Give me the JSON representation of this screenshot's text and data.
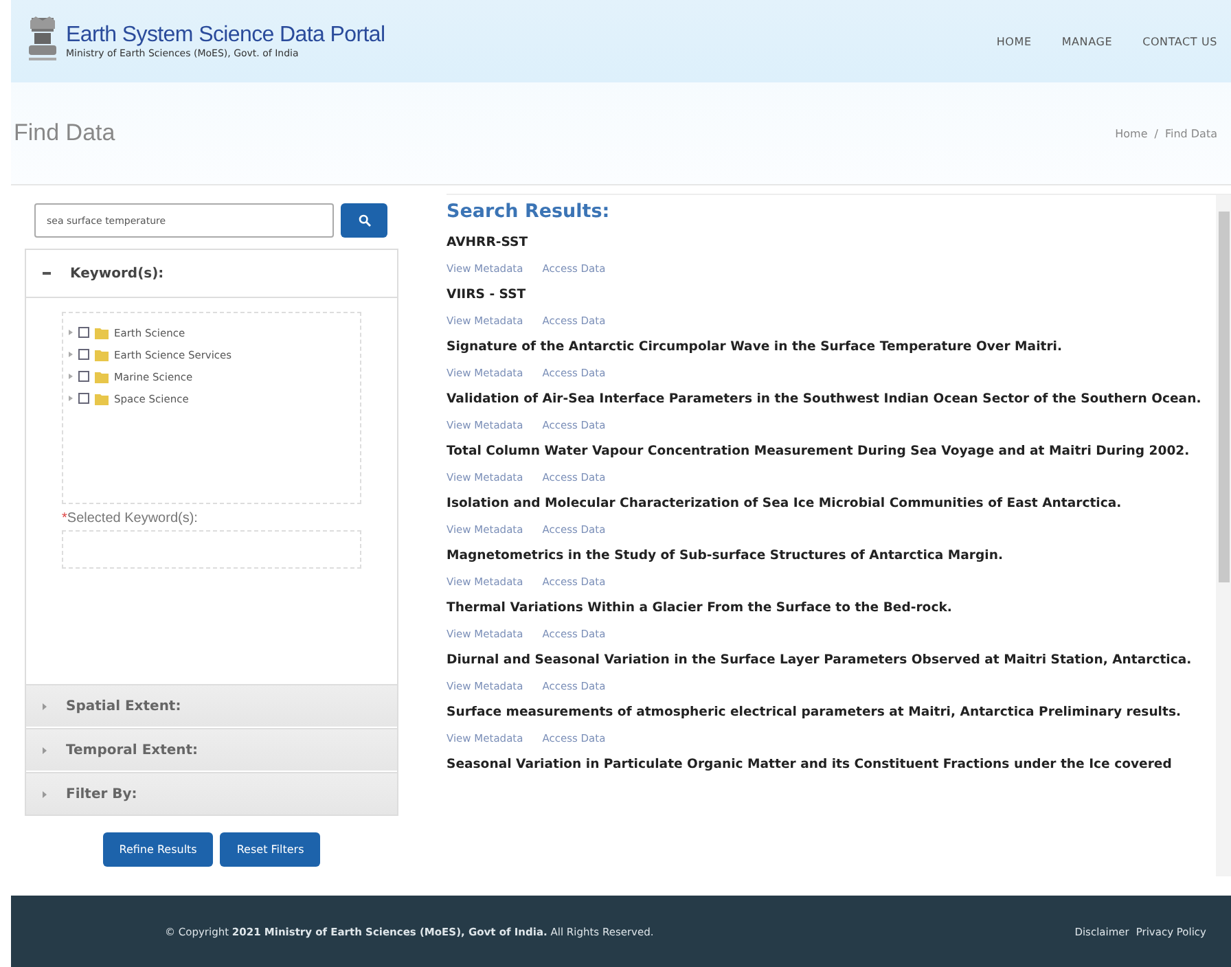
{
  "header": {
    "title": "Earth System Science Data Portal",
    "subtitle": "Ministry of Earth Sciences (MoES), Govt. of India",
    "nav": [
      "HOME",
      "MANAGE",
      "CONTACT US"
    ]
  },
  "page_title": "Find Data",
  "breadcrumb": {
    "items": [
      "Home",
      "Find Data"
    ],
    "separator": "/"
  },
  "search": {
    "value": "sea surface temperature"
  },
  "filters": [
    {
      "title": "Keyword(s):",
      "expanded": true,
      "tree": [
        {
          "label": "Earth Science",
          "checked": false,
          "expanded": false
        },
        {
          "label": "Earth Science Services",
          "checked": false,
          "expanded": false
        },
        {
          "label": "Marine Science",
          "checked": false,
          "expanded": false
        },
        {
          "label": "Space Science",
          "checked": false,
          "expanded": false
        }
      ],
      "selected_label": {
        "required_mark": "*",
        "text": "Selected Keyword(s):"
      }
    },
    {
      "title": "Spatial Extent:",
      "expanded": false
    },
    {
      "title": "Temporal Extent:",
      "expanded": false
    },
    {
      "title": "Filter By:",
      "expanded": false
    }
  ],
  "buttons": [
    "Refine Results",
    "Reset Filters"
  ],
  "results": {
    "heading": "Search Results:",
    "items": [
      {
        "title": "AVHRR-SST",
        "links": [
          "View Metadata",
          "Access Data"
        ]
      },
      {
        "title": "VIIRS - SST",
        "links": [
          "View Metadata",
          "Access Data"
        ]
      },
      {
        "title": "Signature of the Antarctic Circumpolar Wave in the Surface Temperature Over Maitri.",
        "links": [
          "View Metadata",
          "Access Data"
        ]
      },
      {
        "title": "Validation of Air-Sea Interface Parameters in the Southwest Indian Ocean Sector of the Southern Ocean.",
        "links": [
          "View Metadata",
          "Access Data"
        ]
      },
      {
        "title": "Total Column Water Vapour Concentration Measurement During Sea Voyage and at Maitri During 2002.",
        "links": [
          "View Metadata",
          "Access Data"
        ]
      },
      {
        "title": "Isolation and Molecular Characterization of Sea Ice Microbial Communities of East Antarctica.",
        "links": [
          "View Metadata",
          "Access Data"
        ]
      },
      {
        "title": "Magnetometrics in the Study of Sub-surface Structures of Antarctica Margin.",
        "links": [
          "View Metadata",
          "Access Data"
        ]
      },
      {
        "title": "Thermal Variations Within a Glacier From the Surface to the Bed-rock.",
        "links": [
          "View Metadata",
          "Access Data"
        ]
      },
      {
        "title": "Diurnal and Seasonal Variation in the Surface Layer Parameters Observed at Maitri Station, Antarctica.",
        "links": [
          "View Metadata",
          "Access Data"
        ]
      },
      {
        "title": "Surface measurements of atmospheric electrical parameters at Maitri, Antarctica Preliminary results.",
        "links": [
          "View Metadata",
          "Access Data"
        ]
      },
      {
        "title": "Seasonal Variation in Particulate Organic Matter and its Constituent Fractions under the Ice covered"
      }
    ]
  },
  "footer": {
    "copyright": "© Copyright **2021 Ministry of Earth Sciences (MoES), Govt of India.** All Rights Reserved.",
    "links": [
      "Disclaimer",
      "Privacy Policy"
    ]
  }
}
